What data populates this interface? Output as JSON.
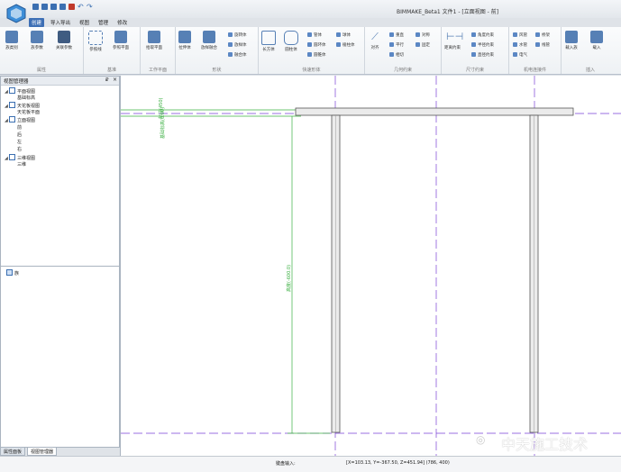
{
  "window": {
    "title": "BIMMAKE_Beta1 文件1 - [立面视图 - 前]"
  },
  "menu": {
    "tabs": [
      {
        "label": "创建",
        "active": true
      },
      {
        "label": "导入导出"
      },
      {
        "label": "视图"
      },
      {
        "label": "管理"
      },
      {
        "label": "修改"
      }
    ]
  },
  "ribbon": {
    "groups": [
      {
        "label": "属性",
        "buttons": [
          "族类别",
          "族参数",
          "关联参数"
        ]
      },
      {
        "label": "基准",
        "buttons": [
          "参照线",
          "参照平面"
        ]
      },
      {
        "label": "工作平面",
        "buttons": [
          "拾取平面"
        ]
      },
      {
        "label": "形状",
        "buttons": [
          "拉伸体",
          "放样融合"
        ],
        "small": [
          "旋转体",
          "放样体",
          "融合体"
        ]
      },
      {
        "label": "快速形体",
        "buttons": [
          "长方体",
          "圆柱体"
        ],
        "small": [
          "管体",
          "圆环体",
          "圆锥体",
          "球体",
          "棱柱体"
        ]
      },
      {
        "label": "几何约束",
        "buttons": [
          "对齐"
        ],
        "small": [
          "重直",
          "平行",
          "相切",
          "对称",
          "固定"
        ]
      },
      {
        "label": "尺寸约束",
        "buttons": [
          "距离约束"
        ],
        "small": [
          "角度约束",
          "半径约束",
          "直径约束"
        ]
      },
      {
        "label": "机电连接件",
        "small": [
          "风管",
          "水管",
          "电气",
          "桥架",
          "线管"
        ]
      },
      {
        "label": "插入",
        "buttons": [
          "载入族",
          "载入"
        ]
      }
    ]
  },
  "view_panel": {
    "title": "视图管理器",
    "pin": "₽",
    "close": "×",
    "tree": [
      {
        "label": "平面视图",
        "level": 0,
        "folder": true
      },
      {
        "label": "基础标高",
        "level": 1
      },
      {
        "label": "天花板视图",
        "level": 0,
        "folder": true
      },
      {
        "label": "天花板平面",
        "level": 1
      },
      {
        "label": "立面视图",
        "level": 0,
        "folder": true
      },
      {
        "label": "前",
        "level": 1
      },
      {
        "label": "后",
        "level": 1
      },
      {
        "label": "左",
        "level": 1
      },
      {
        "label": "右",
        "level": 1
      },
      {
        "label": "三维视图",
        "level": 0,
        "folder": true
      },
      {
        "label": "三维",
        "level": 1
      }
    ]
  },
  "family_panel": {
    "item": "族"
  },
  "bottom_tabs": [
    {
      "label": "属性面板"
    },
    {
      "label": "视图管理器",
      "active": true
    }
  ],
  "canvas": {
    "dim_top": "标注(450)",
    "dim_left": "基础标高(0.00)",
    "dim_vertical": "高度(-600.0)"
  },
  "status": {
    "label": "键盘输入:",
    "coords": "[X=103.13, Y=-367.50, Z=451.94] (786, 400)"
  },
  "watermark": "中天施工技术",
  "colors": {
    "accent": "#3d6fb5",
    "guide": "#7a40d6",
    "dim": "#3cb043"
  }
}
